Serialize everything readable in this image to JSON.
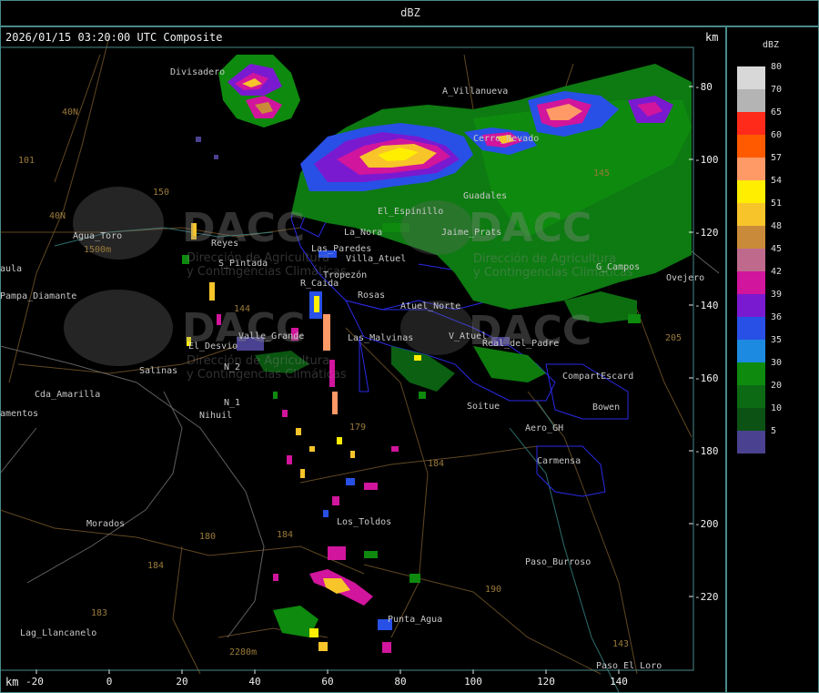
{
  "header": {
    "title": "dBZ"
  },
  "map": {
    "timestamp": "2026/01/15 03:20:00 UTC Composite",
    "km_label_top": "km",
    "km_label_bottom": "km",
    "y_ticks": [
      "-80",
      "-100",
      "-120",
      "-140",
      "-160",
      "-180",
      "-200",
      "-220"
    ],
    "x_ticks": [
      "-20",
      "0",
      "20",
      "40",
      "60",
      "80",
      "100",
      "120",
      "140"
    ],
    "places": [
      "Divisadero",
      "A_Villanueva",
      "Guadales",
      "La_Nora",
      "El_Espinillo",
      "Agua_Toro",
      "Reyes",
      "S_Pintada",
      "Las_Paredes",
      "Villa_Atuel",
      "Jaime_Prats",
      "Tropezón",
      "R_Caida",
      "Rosas",
      "Atuel_Norte",
      "Valle_Grande",
      "Las_Malvinas",
      "El_Desvio",
      "Salinas",
      "N_2",
      "N_1",
      "Nihuil",
      "Cda_Amarilla",
      "aula",
      "Pampa_Diamante",
      "V_Atuel",
      "Real_del_Padre",
      "CompartEscard",
      "Soitue",
      "Aero_GH",
      "Bowen",
      "Carmensa",
      "G_Campos",
      "Ovejero",
      "Los_Toldos",
      "Morados",
      "Paso_Burroso",
      "Punta_Agua",
      "Lag_Llancanelo",
      "Paso_El_Loro",
      "amentos",
      "Cerro_Nevado"
    ],
    "route_labels": [
      "101",
      "40N",
      "150",
      "40N",
      "144",
      "179",
      "184",
      "184",
      "180",
      "184",
      "183",
      "190",
      "205",
      "143",
      "145",
      "2280m",
      "1500m"
    ],
    "watermark": {
      "brand": "DACC",
      "line1": "Dirección de Agricultura",
      "line2": "y Contingencias Climáticas"
    }
  },
  "legend": {
    "title": "dBZ",
    "levels": [
      {
        "value": "80",
        "color": "#d8d8d8"
      },
      {
        "value": "70",
        "color": "#b4b4b4"
      },
      {
        "value": "65",
        "color": "#ff2a1a"
      },
      {
        "value": "60",
        "color": "#ff5a00"
      },
      {
        "value": "57",
        "color": "#ff9966"
      },
      {
        "value": "54",
        "color": "#ffee00"
      },
      {
        "value": "51",
        "color": "#f7c52a"
      },
      {
        "value": "48",
        "color": "#c98b3a"
      },
      {
        "value": "45",
        "color": "#bf6a8c"
      },
      {
        "value": "42",
        "color": "#d1159c"
      },
      {
        "value": "39",
        "color": "#7a1ad0"
      },
      {
        "value": "36",
        "color": "#2850e6"
      },
      {
        "value": "35",
        "color": "#1c8ae0"
      },
      {
        "value": "30",
        "color": "#0e8a0e"
      },
      {
        "value": "20",
        "color": "#0c6a14"
      },
      {
        "value": "10",
        "color": "#0c5214"
      },
      {
        "value": "5",
        "color": "#4a4290"
      }
    ]
  }
}
